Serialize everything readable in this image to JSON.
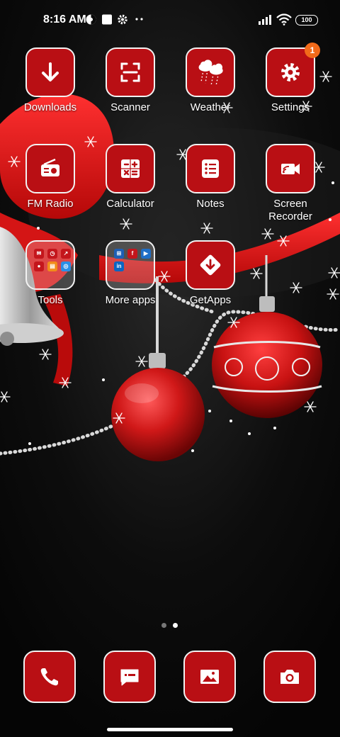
{
  "status_bar": {
    "time": "8:16 AM",
    "battery": "100"
  },
  "apps": [
    {
      "label": "Downloads",
      "icon": "download-arrow-icon"
    },
    {
      "label": "Scanner",
      "icon": "scan-frame-icon"
    },
    {
      "label": "Weather",
      "icon": "cloud-rain-icon"
    },
    {
      "label": "Settings",
      "icon": "gear-icon",
      "badge": "1"
    },
    {
      "label": "FM Radio",
      "icon": "radio-icon"
    },
    {
      "label": "Calculator",
      "icon": "calculator-icon"
    },
    {
      "label": "Notes",
      "icon": "notes-list-icon"
    },
    {
      "label": "Screen\nRecorder",
      "icon": "video-camera-icon"
    },
    {
      "label": "Tools",
      "icon": "folder-icon"
    },
    {
      "label": "More apps",
      "icon": "folder-icon"
    },
    {
      "label": "GetApps",
      "icon": "getapps-icon"
    }
  ],
  "page_indicator": {
    "pages": 2,
    "current": 2
  },
  "dock": [
    {
      "icon": "phone-icon"
    },
    {
      "icon": "messages-icon"
    },
    {
      "icon": "gallery-icon"
    },
    {
      "icon": "camera-icon"
    }
  ],
  "colors": {
    "tile": "#b90f14",
    "badge": "#f26a1a",
    "background": "#0a0a0a"
  }
}
